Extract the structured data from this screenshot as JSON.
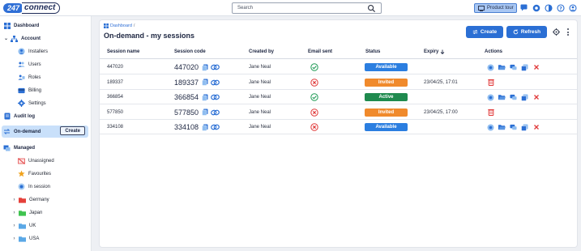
{
  "brand": {
    "logo_number": "247",
    "logo_word": "connect"
  },
  "search": {
    "placeholder": "Search"
  },
  "header": {
    "tour_label": "Product tour",
    "icons": [
      "chat-icon",
      "help-circle-icon",
      "contrast-icon",
      "question-icon",
      "user-settings-icon"
    ]
  },
  "sidebar": {
    "dashboard": "Dashboard",
    "account": "Account",
    "installers": "Installers",
    "users": "Users",
    "roles": "Roles",
    "billing": "Billing",
    "settings": "Settings",
    "audit_log": "Audit log",
    "on_demand": "On-demand",
    "create_label": "Create",
    "managed": "Managed",
    "unassigned": "Unassigned",
    "favourites": "Favourites",
    "in_session": "In session",
    "groups": [
      {
        "label": "Germany",
        "color": "#e5403a"
      },
      {
        "label": "Japan",
        "color": "#3fc34f"
      },
      {
        "label": "UK",
        "color": "#5aa8e6"
      },
      {
        "label": "USA",
        "color": "#5aa8e6"
      }
    ]
  },
  "page": {
    "breadcrumb": "Dashboard",
    "breadcrumb_sep": "/",
    "title": "On-demand - my sessions",
    "create_button": "Create",
    "refresh_button": "Refresh"
  },
  "table": {
    "headers": {
      "session_name": "Session name",
      "session_code": "Session code",
      "created_by": "Created by",
      "email_sent": "Email sent",
      "status": "Status",
      "expiry": "Expiry",
      "actions": "Actions"
    },
    "rows": [
      {
        "name": "447020",
        "code": "447020",
        "creator": "Jane Neal",
        "email": "sent",
        "status": "Available",
        "expiry": ""
      },
      {
        "name": "189337",
        "code": "189337",
        "creator": "Jane Neal",
        "email": "failed",
        "status": "Invited",
        "expiry": "23/04/25, 17:01"
      },
      {
        "name": "366854",
        "code": "366854",
        "creator": "Jane Neal",
        "email": "sent",
        "status": "Active",
        "expiry": ""
      },
      {
        "name": "577850",
        "code": "577850",
        "creator": "Jane Neal",
        "email": "failed",
        "status": "Invited",
        "expiry": "23/04/25, 17:00"
      },
      {
        "name": "334108",
        "code": "334108",
        "creator": "Jane Neal",
        "email": "failed",
        "status": "Available",
        "expiry": ""
      }
    ]
  },
  "colors": {
    "primary": "#2b6fd4",
    "available": "#2b7ee0",
    "invited": "#f08a2c",
    "active": "#1f8a4e",
    "success": "#1f9a55",
    "danger": "#e03a3a"
  }
}
